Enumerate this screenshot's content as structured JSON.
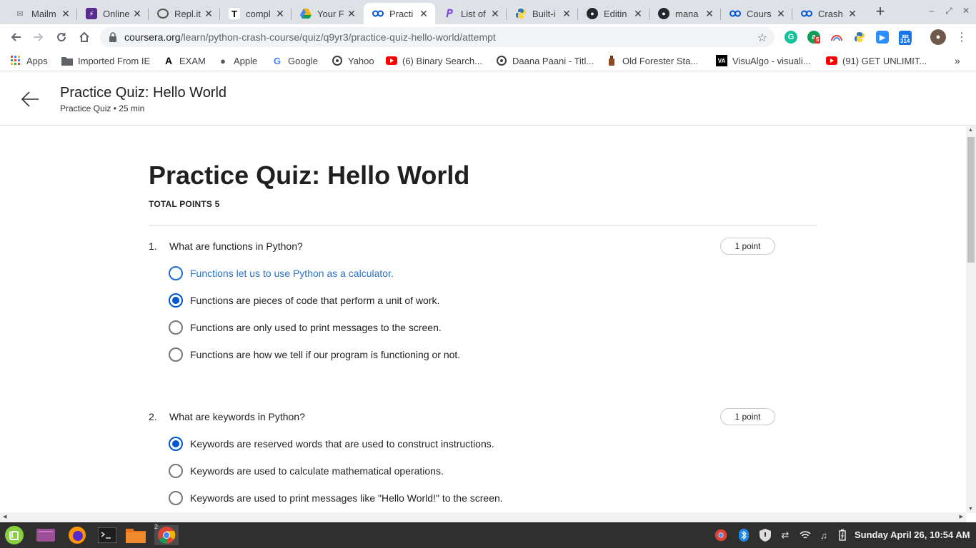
{
  "browser": {
    "tabs": [
      {
        "label": "Mailm",
        "icon": "mail-icon",
        "color": "#777777"
      },
      {
        "label": "Online",
        "icon": "bolt-icon",
        "color": "#5b2c8f"
      },
      {
        "label": "Repl.it",
        "icon": "replit-icon",
        "color": "#555555"
      },
      {
        "label": "compl",
        "icon": "t-icon",
        "color": "#000000"
      },
      {
        "label": "Your F",
        "icon": "drive-icon",
        "color": "#f4b400"
      },
      {
        "label": "Practi",
        "icon": "coursera-icon",
        "color": "#0056d2"
      },
      {
        "label": "List of",
        "icon": "p-icon",
        "color": "#7b3fe4"
      },
      {
        "label": "Built-i",
        "icon": "python-icon",
        "color": "#3776ab"
      },
      {
        "label": "Editin",
        "icon": "github-icon",
        "color": "#24292e"
      },
      {
        "label": "mana",
        "icon": "github-icon",
        "color": "#24292e"
      },
      {
        "label": "Cours",
        "icon": "coursera-icon",
        "color": "#0056d2"
      },
      {
        "label": "Crash",
        "icon": "coursera-icon",
        "color": "#0056d2"
      }
    ],
    "url_domain": "coursera.org",
    "url_path": "/learn/python-crash-course/quiz/q9yr3/practice-quiz-hello-world/attempt",
    "extension_badges": {
      "grammarly_count": "5",
      "calendar_count": "314"
    }
  },
  "bookmarks": [
    {
      "label": "Apps",
      "icon": "apps-grid-icon"
    },
    {
      "label": "Imported From IE",
      "icon": "folder-icon"
    },
    {
      "label": "EXAM",
      "icon": "a-logo-icon"
    },
    {
      "label": "Apple",
      "icon": "apple-icon"
    },
    {
      "label": "Google",
      "icon": "google-icon"
    },
    {
      "label": "Yahoo",
      "icon": "globe-icon"
    },
    {
      "label": "(6) Binary Search...",
      "icon": "youtube-icon"
    },
    {
      "label": "Daana Paani - Titl...",
      "icon": "globe-icon"
    },
    {
      "label": "Old Forester Sta...",
      "icon": "bottle-icon"
    },
    {
      "label": "VisuAlgo - visuali...",
      "icon": "visualgo-icon"
    },
    {
      "label": "(91) GET UNLIMIT...",
      "icon": "youtube-icon"
    }
  ],
  "header": {
    "title": "Practice Quiz: Hello World",
    "subtitle": "Practice Quiz • 25 min"
  },
  "quiz": {
    "title": "Practice Quiz: Hello World",
    "total_points": "TOTAL POINTS 5",
    "questions": [
      {
        "number": "1.",
        "text": "What are functions in Python?",
        "points": "1 point",
        "options": [
          {
            "label": "Functions let us to use Python as a calculator.",
            "selected": false
          },
          {
            "label": "Functions are pieces of code that perform a unit of work.",
            "selected": true
          },
          {
            "label": "Functions are only used to print messages to the screen.",
            "selected": false
          },
          {
            "label": "Functions are how we tell if our program is functioning or not.",
            "selected": false
          }
        ]
      },
      {
        "number": "2.",
        "text": "What are keywords in Python?",
        "points": "1 point",
        "options": [
          {
            "label": "Keywords are reserved words that are used to construct instructions.",
            "selected": true
          },
          {
            "label": "Keywords are used to calculate mathematical operations.",
            "selected": false
          },
          {
            "label": "Keywords are used to print messages like \"Hello World!\" to the screen.",
            "selected": false
          }
        ]
      }
    ]
  },
  "taskbar": {
    "workspace_count": "2",
    "clock": "Sunday April 26, 10:54 AM"
  },
  "colors": {
    "accent": "#0056d2",
    "hover_text": "#2a73cc"
  }
}
